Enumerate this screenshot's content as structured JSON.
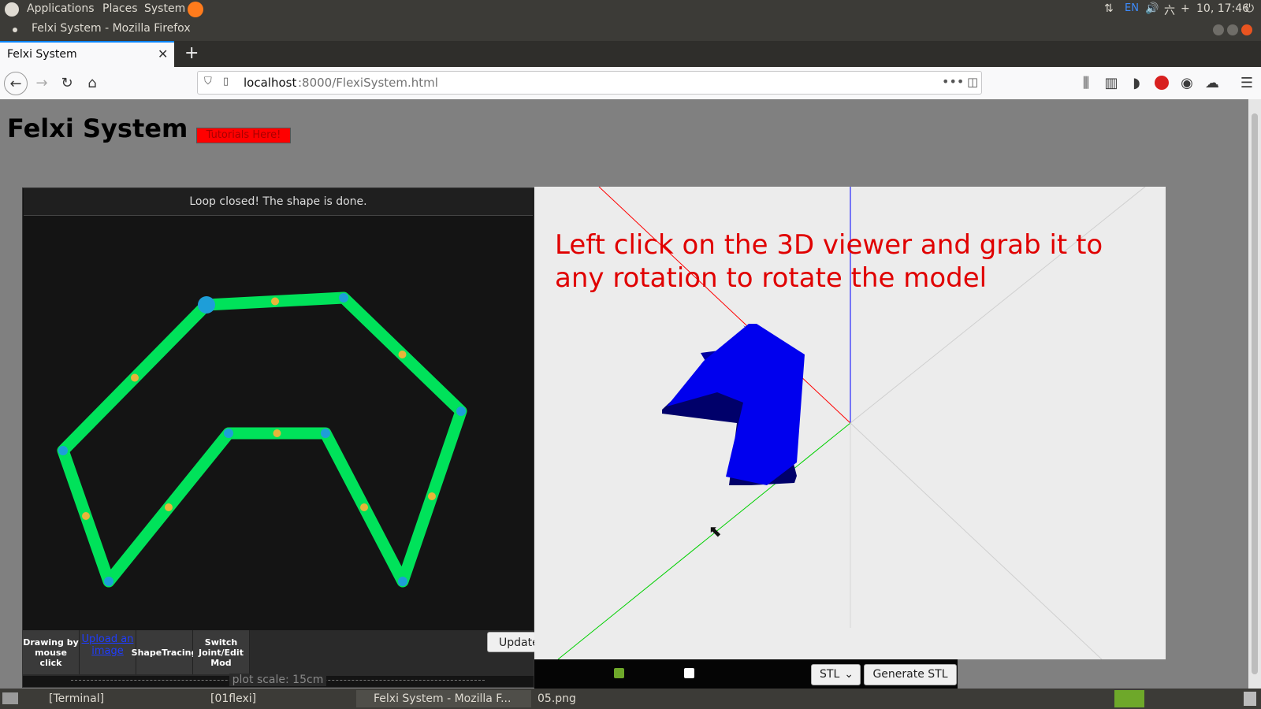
{
  "top_panel": {
    "menus": [
      "Applications",
      "Places",
      "System"
    ],
    "lang": "EN",
    "clock": "10, 17:46",
    "day": "六"
  },
  "window": {
    "title": "Felxi System - Mozilla Firefox"
  },
  "tab": {
    "label": "Felxi System"
  },
  "url": {
    "host": "localhost",
    "rest": ":8000/FlexiSystem.html"
  },
  "page": {
    "title": "Felxi System",
    "tutorial_button": "Tutorials Here!",
    "status": "Loop closed! The shape is done.",
    "tools": [
      "Drawing by mouse click",
      "Upload an image",
      "ShapeTracing",
      "Switch Joint/Edit Mod"
    ],
    "update_button": "Update",
    "scale_label": "plot scale: 15cm",
    "viewer_hint": "Left click on the 3D viewer and grab it to any rotation to rotate the model",
    "stl_select": "STL",
    "generate_button": "Generate STL"
  },
  "taskbar": {
    "items": [
      "[Terminal]",
      "[01flexi]",
      "Felxi System - Mozilla F...",
      "05.png"
    ]
  },
  "colors": {
    "path": "#00e25a",
    "joint": "#1e9ed8",
    "midpoint": "#e8b53a",
    "model": "#0000ee",
    "hint": "#e00000",
    "tutorial_bg": "#ff0000"
  }
}
